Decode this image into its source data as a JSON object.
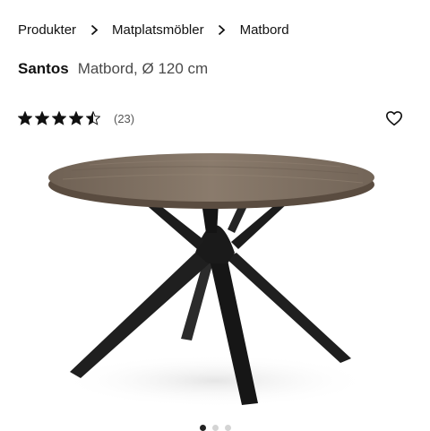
{
  "breadcrumb": {
    "items": [
      {
        "label": "Produkter"
      },
      {
        "label": "Matplatsmöbler"
      },
      {
        "label": "Matbord"
      }
    ]
  },
  "product": {
    "name": "Santos",
    "description": "Matbord, Ø 120 cm"
  },
  "rating": {
    "value": 4.5,
    "max": 5,
    "count_label": "(23)"
  },
  "icons": {
    "separator": "chevron-right-icon",
    "star": "star-icon",
    "wishlist": "heart-outline-icon"
  },
  "gallery": {
    "total": 3,
    "active_index": 0
  },
  "colors": {
    "text": "#111111",
    "star": "#111111",
    "tabletop": "#7a6a5c",
    "legs": "#1f1f1f"
  }
}
